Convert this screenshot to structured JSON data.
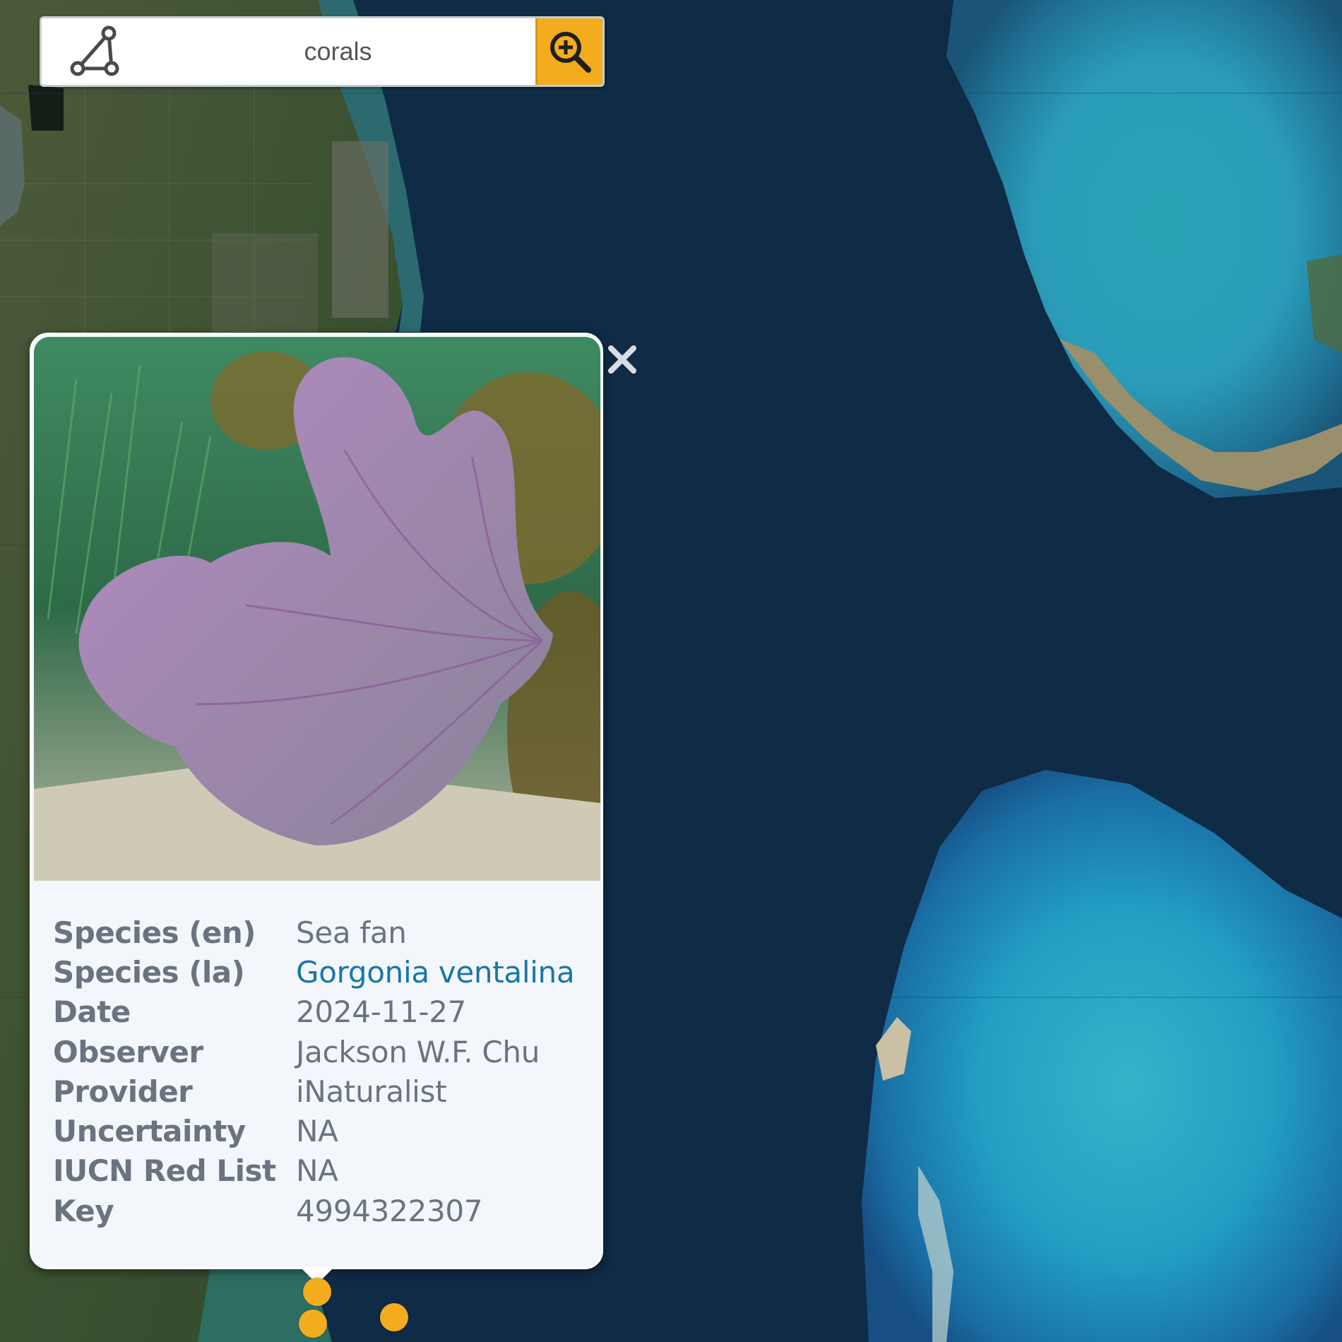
{
  "search": {
    "value": "corals",
    "draw_icon": "polygon-draw-icon",
    "search_icon": "zoom-in-search-icon",
    "accent_color": "#f2ac1e"
  },
  "popup": {
    "image_subject": "sea fan",
    "close_icon": "close-icon",
    "rows": [
      {
        "label": "Species (en)",
        "value": "Sea fan"
      },
      {
        "label": "Species (la)",
        "value": "Gorgonia ventalina"
      },
      {
        "label": "Date",
        "value": "2024-11-27"
      },
      {
        "label": "Observer",
        "value": "Jackson W.F. Chu"
      },
      {
        "label": "Provider",
        "value": "iNaturalist"
      },
      {
        "label": "Uncertainty",
        "value": "NA"
      },
      {
        "label": "IUCN Red List",
        "value": "NA"
      },
      {
        "label": "Key",
        "value": "4994322307"
      }
    ],
    "link_color": "#1b76a6"
  },
  "markers": {
    "count": 3,
    "color": "#f2ac1e"
  }
}
